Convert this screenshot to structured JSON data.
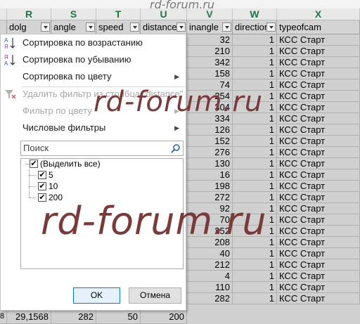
{
  "columns": [
    {
      "letter": "R",
      "header": "dolg"
    },
    {
      "letter": "S",
      "header": "angle"
    },
    {
      "letter": "T",
      "header": "speed"
    },
    {
      "letter": "U",
      "header": "distance"
    },
    {
      "letter": "V",
      "header": "inangle"
    },
    {
      "letter": "W",
      "header": "direction"
    },
    {
      "letter": "X",
      "header": "typeofcam"
    }
  ],
  "rows": [
    {
      "inangle": "32",
      "direction": "1",
      "typeofcam": "КСС Старт"
    },
    {
      "inangle": "210",
      "direction": "1",
      "typeofcam": "КСС Старт"
    },
    {
      "inangle": "342",
      "direction": "1",
      "typeofcam": "КСС Старт"
    },
    {
      "inangle": "158",
      "direction": "1",
      "typeofcam": "КСС Старт"
    },
    {
      "inangle": "74",
      "direction": "1",
      "typeofcam": "КСС Старт"
    },
    {
      "inangle": "254",
      "direction": "1",
      "typeofcam": "КСС Старт"
    },
    {
      "inangle": "304",
      "direction": "1",
      "typeofcam": "КСС Старт"
    },
    {
      "inangle": "334",
      "direction": "1",
      "typeofcam": "КСС Старт"
    },
    {
      "inangle": "126",
      "direction": "1",
      "typeofcam": "КСС Старт"
    },
    {
      "inangle": "152",
      "direction": "1",
      "typeofcam": "КСС Старт"
    },
    {
      "inangle": "276",
      "direction": "1",
      "typeofcam": "КСС Старт"
    },
    {
      "inangle": "130",
      "direction": "1",
      "typeofcam": "КСС Старт"
    },
    {
      "inangle": "16",
      "direction": "1",
      "typeofcam": "КСС Старт"
    },
    {
      "inangle": "198",
      "direction": "1",
      "typeofcam": "КСС Старт"
    },
    {
      "inangle": "272",
      "direction": "1",
      "typeofcam": "КСС Старт"
    },
    {
      "inangle": "92",
      "direction": "1",
      "typeofcam": "КСС Старт"
    },
    {
      "inangle": "70",
      "direction": "1",
      "typeofcam": "КСС Старт"
    },
    {
      "inangle": "252",
      "direction": "1",
      "typeofcam": "КСС Старт"
    },
    {
      "inangle": "208",
      "direction": "1",
      "typeofcam": "КСС Старт"
    },
    {
      "inangle": "40",
      "direction": "1",
      "typeofcam": "КСС Старт"
    },
    {
      "inangle": "212",
      "direction": "1",
      "typeofcam": "КСС Старт"
    },
    {
      "inangle": "4",
      "direction": "1",
      "typeofcam": "КСС Старт"
    },
    {
      "inangle": "110",
      "direction": "1",
      "typeofcam": "КСС Старт"
    },
    {
      "inangle": "282",
      "direction": "1",
      "typeofcam": "КСС Старт"
    }
  ],
  "partial_bottom_row": {
    "row_num": "8",
    "dolg": "29,1568",
    "angle": "282",
    "speed": "50",
    "distance": "200"
  },
  "filter_menu": {
    "sort_asc": "Сортировка по возрастанию",
    "sort_desc": "Сортировка по убыванию",
    "sort_color": "Сортировка по цвету",
    "clear_filter": "Удалить фильтр из столбца \"distance\"",
    "filter_color": "Фильтр по цвету",
    "number_filters": "Числовые фильтры",
    "search_placeholder": "Поиск",
    "select_all": "(Выделить все)",
    "values": [
      "5",
      "10",
      "200"
    ],
    "ok": "OK",
    "cancel": "Отмена"
  },
  "watermark": "rd-forum.ru",
  "colors": {
    "accent": "#217346",
    "ok_border": "#0078d7",
    "sheet_bg": "#d0d0d0"
  }
}
